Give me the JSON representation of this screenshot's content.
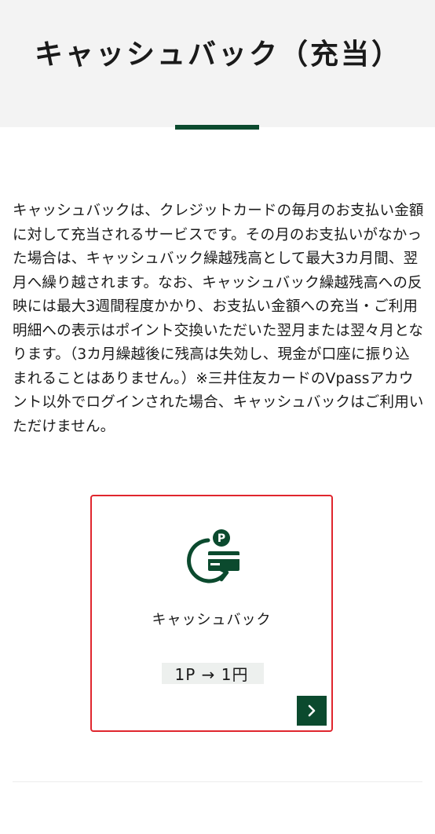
{
  "header": {
    "title": "キャッシュバック（充当）"
  },
  "description": "キャッシュバックは、クレジットカードの毎月のお支払い金額に対して充当されるサービスです。その月のお支払いがなかった場合は、キャッシュバック繰越残高として最大3カ月間、翌月へ繰り越されます。なお、キャッシュバック繰越残高への反映には最大3週間程度かかり、お支払い金額への充当・ご利用明細への表示はポイント交換いただいた翌月または翌々月となります。（3カ月繰越後に残高は失効し、現金が口座に振り込まれることはありません。）※三井住友カードのVpassアカウント以外でログインされた場合、キャッシュバックはご利用いただけません。",
  "card": {
    "icon": "cashback-point-card-icon",
    "icon_letter": "P",
    "title": "キャッシュバック",
    "rate": "1P → 1円",
    "arrow_icon": "chevron-right-icon",
    "highlight_color": "#e0262e",
    "accent_color": "#0b4a2e"
  }
}
